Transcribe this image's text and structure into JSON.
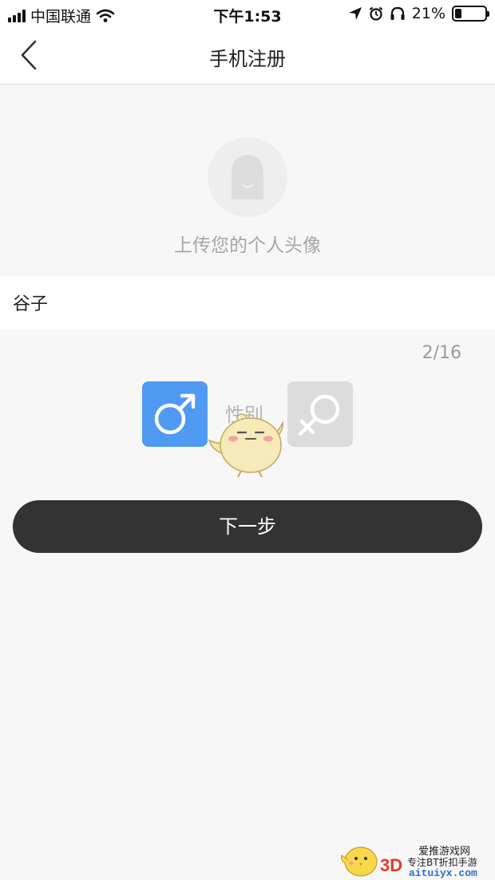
{
  "status_bar": {
    "carrier": "中国联通",
    "time": "下午1:53",
    "battery": "21%",
    "battery_level": 0.21
  },
  "nav": {
    "title": "手机注册"
  },
  "avatar": {
    "hint": "上传您的个人头像"
  },
  "nickname": {
    "value": "谷子",
    "count": "2/16"
  },
  "gender": {
    "label": "性别",
    "selected": "male",
    "male_color": "#4f9af2",
    "female_color": "#dcdcdc"
  },
  "next_button": {
    "label": "下一步"
  },
  "watermark": {
    "brand": "3D",
    "line1": "爱推游戏网",
    "line2": "专注BT折扣手游",
    "line3": "aituiyx.com"
  }
}
